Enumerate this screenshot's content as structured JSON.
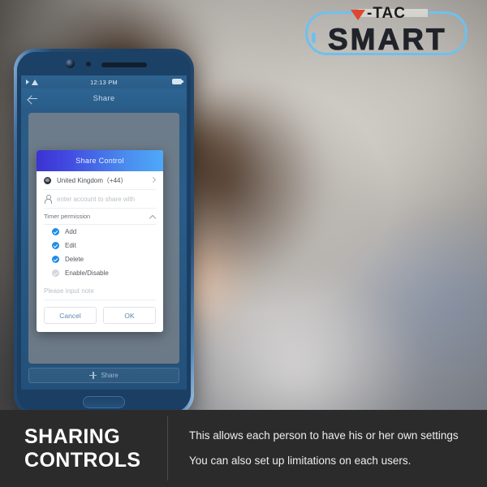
{
  "logo": {
    "brand_mark": "V",
    "brand_word": "-TAC",
    "brand_sub": "SMART",
    "accent_red": "#e0462e",
    "accent_blue": "#6fc0ee"
  },
  "phone": {
    "status_bar": {
      "time": "12:13 PM",
      "wifi_icon": "wifi-icon",
      "battery_icon": "battery-icon",
      "location_icon": "location-arrow-icon"
    },
    "nav": {
      "back_icon": "back-arrow-icon",
      "title": "Share"
    },
    "share_bar": {
      "icon": "plus-icon",
      "label": "Share"
    },
    "home_button": "home-button"
  },
  "dialog": {
    "title": "Share Control",
    "header_gradient_from": "#3b33d1",
    "header_gradient_to": "#4fa9f7",
    "country": {
      "icon": "flag-icon",
      "label": "United Kingdom（+44）",
      "chevron": "chevron-right-icon"
    },
    "account": {
      "icon": "person-icon",
      "placeholder": "enter account to share with"
    },
    "section": {
      "label": "Timer permission",
      "chevron": "chevron-up-icon"
    },
    "permissions": [
      {
        "label": "Add",
        "checked": true
      },
      {
        "label": "Edit",
        "checked": true
      },
      {
        "label": "Delete",
        "checked": true
      },
      {
        "label": "Enable/Disable",
        "checked": false
      }
    ],
    "note": {
      "placeholder": "Please input note"
    },
    "cancel_label": "Cancel",
    "ok_label": "OK"
  },
  "banner": {
    "title_line1": "SHARING",
    "title_line2": "CONTROLS",
    "paragraph1": "This allows each person to have his or her own settings",
    "paragraph2": "You can also set up limitations on each users."
  }
}
